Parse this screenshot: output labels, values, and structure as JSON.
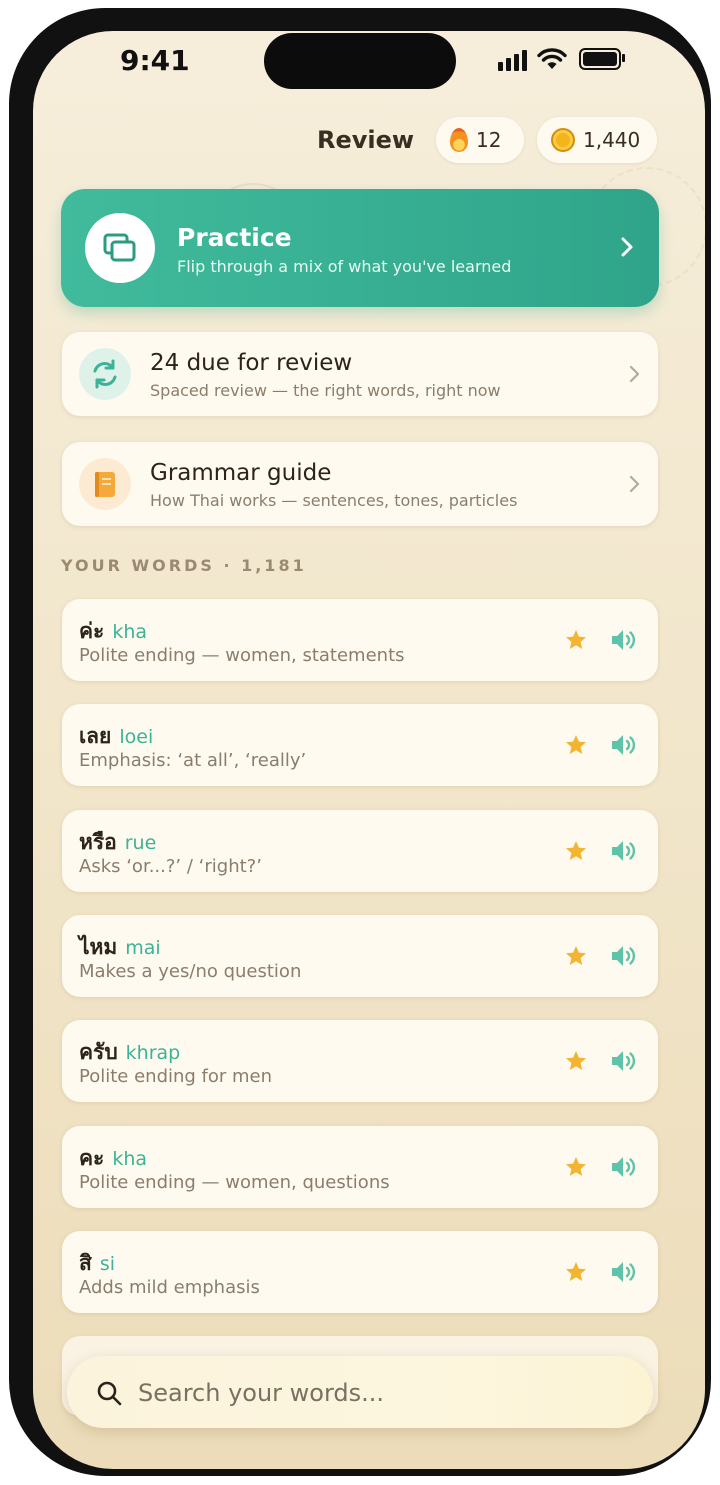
{
  "status_bar": {
    "time": "9:41"
  },
  "header": {
    "title": "Review",
    "streak": "12",
    "coins": "1,440"
  },
  "practice": {
    "title": "Practice",
    "subtitle": "Flip through a mix of what you've learned",
    "icon": "cards-icon"
  },
  "review": {
    "title": "24 due for review",
    "subtitle": "Spaced review — the right words, right now",
    "icon": "refresh-icon"
  },
  "grammar": {
    "title": "Grammar guide",
    "subtitle": "How Thai works — sentences, tones, particles",
    "icon": "book-icon"
  },
  "words_section": {
    "label": "YOUR WORDS · 1,181"
  },
  "words": [
    {
      "thai": "ค่ะ",
      "roman": "kha",
      "def": "Polite ending — women, statements"
    },
    {
      "thai": "เลย",
      "roman": "loei",
      "def": "Emphasis: ‘at all’, ‘really’"
    },
    {
      "thai": "หรือ",
      "roman": "rue",
      "def": "Asks ‘or...?’ / ‘right?’"
    },
    {
      "thai": "ไหม",
      "roman": "mai",
      "def": "Makes a yes/no question"
    },
    {
      "thai": "ครับ",
      "roman": "khrap",
      "def": "Polite ending for men"
    },
    {
      "thai": "คะ",
      "roman": "kha",
      "def": "Polite ending — women, questions"
    },
    {
      "thai": "สิ",
      "roman": "si",
      "def": "Adds mild emphasis"
    }
  ],
  "search": {
    "placeholder": "Search your words..."
  },
  "colors": {
    "accent_green": "#3cb396",
    "star": "#f2b431",
    "background": "#f3e8cf"
  }
}
